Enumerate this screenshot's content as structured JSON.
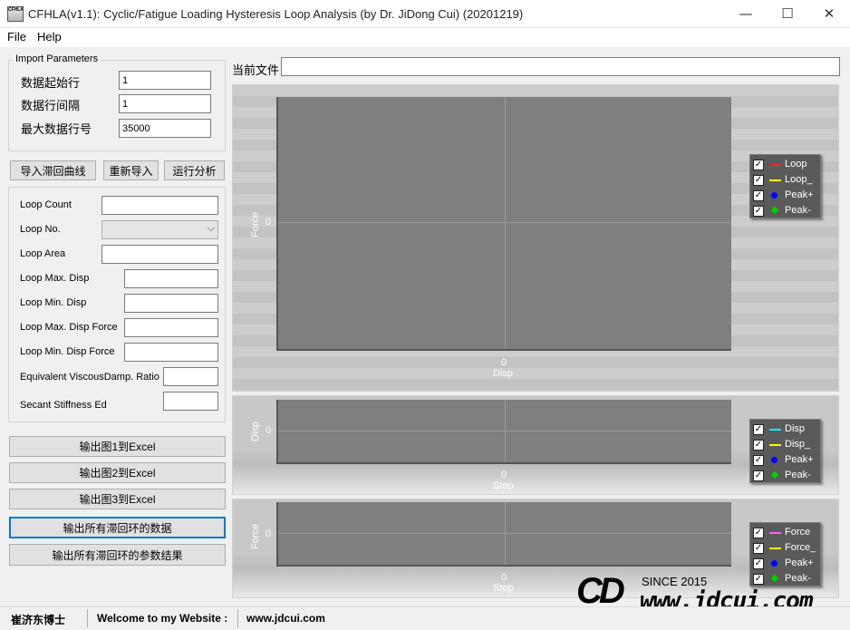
{
  "window": {
    "icon_text": "CFHLA",
    "title": "CFHLA(v1.1): Cyclic/Fatigue Loading Hysteresis Loop Analysis (by Dr. JiDong Cui) (20201219)",
    "minimize": "—",
    "maximize": "☐",
    "close": "✕"
  },
  "menu": {
    "file": "File",
    "help": "Help"
  },
  "import": {
    "group_title": "Import Parameters",
    "start_row_label": "数据起始行",
    "start_row_value": "1",
    "row_interval_label": "数据行间隔",
    "row_interval_value": "1",
    "max_row_label": "最大数据行号",
    "max_row_value": "35000"
  },
  "actions": {
    "import_curve": "导入滞回曲线",
    "reimport": "重新导入",
    "run_analysis": "运行分析"
  },
  "loop_params": {
    "loop_count_label": "Loop Count",
    "loop_count_value": "",
    "loop_no_label": "Loop No.",
    "loop_no_value": "",
    "loop_area_label": "Loop Area",
    "loop_area_value": "",
    "max_disp_label": "Loop Max. Disp",
    "max_disp_value": "",
    "min_disp_label": "Loop Min. Disp",
    "min_disp_value": "",
    "max_disp_force_label": "Loop Max. Disp Force",
    "max_disp_force_value": "",
    "min_disp_force_label": "Loop Min. Disp Force",
    "min_disp_force_value": "",
    "eq_damp_label": "Equivalent ViscousDamp. Ratio",
    "eq_damp_value": "",
    "secant_label": "Secant Stiffness Ed",
    "secant_value": ""
  },
  "export": {
    "chart1": "输出图1到Excel",
    "chart2": "输出图2到Excel",
    "chart3": "输出图3到Excel",
    "all_loops": "输出所有滞回环的数据",
    "all_params": "输出所有滞回环的参数结果"
  },
  "current_file": {
    "label": "当前文件",
    "value": ""
  },
  "chart_data": [
    {
      "type": "line",
      "xlabel": "Disp",
      "ylabel": "Force",
      "x_ticks": [
        "0"
      ],
      "y_ticks": [
        "0"
      ],
      "series": [
        {
          "name": "Loop",
          "color": "#ff2020",
          "marker": "line",
          "values": []
        },
        {
          "name": "Loop_",
          "color": "#ffff00",
          "marker": "line",
          "values": []
        },
        {
          "name": "Peak+",
          "color": "#0000ff",
          "marker": "circle",
          "values": []
        },
        {
          "name": "Peak-",
          "color": "#00d000",
          "marker": "diamond",
          "values": []
        }
      ],
      "grid": true,
      "legend": "right"
    },
    {
      "type": "line",
      "xlabel": "Step",
      "ylabel": "Disp",
      "x_ticks": [
        "0"
      ],
      "y_ticks": [
        "0"
      ],
      "series": [
        {
          "name": "Disp",
          "color": "#00ffff",
          "marker": "line",
          "values": []
        },
        {
          "name": "Disp_",
          "color": "#ffff00",
          "marker": "line",
          "values": []
        },
        {
          "name": "Peak+",
          "color": "#0000ff",
          "marker": "circle",
          "values": []
        },
        {
          "name": "Peak-",
          "color": "#00d000",
          "marker": "diamond",
          "values": []
        }
      ],
      "grid": true,
      "legend": "right"
    },
    {
      "type": "line",
      "xlabel": "Step",
      "ylabel": "Force",
      "x_ticks": [
        "0"
      ],
      "y_ticks": [
        "0"
      ],
      "series": [
        {
          "name": "Force",
          "color": "#ff60ff",
          "marker": "line",
          "values": []
        },
        {
          "name": "Force_",
          "color": "#ffff00",
          "marker": "line",
          "values": []
        },
        {
          "name": "Peak+",
          "color": "#0000ff",
          "marker": "circle",
          "values": []
        },
        {
          "name": "Peak-",
          "color": "#00d000",
          "marker": "diamond",
          "values": []
        }
      ],
      "grid": true,
      "legend": "right"
    }
  ],
  "legend_check": "✓",
  "watermark": {
    "logo": "CD",
    "since": "SINCE 2015",
    "site": "www.jdcui.com"
  },
  "status": {
    "author": "崔济东博士",
    "welcome": "Welcome to my Website :",
    "website": "www.jdcui.com"
  }
}
